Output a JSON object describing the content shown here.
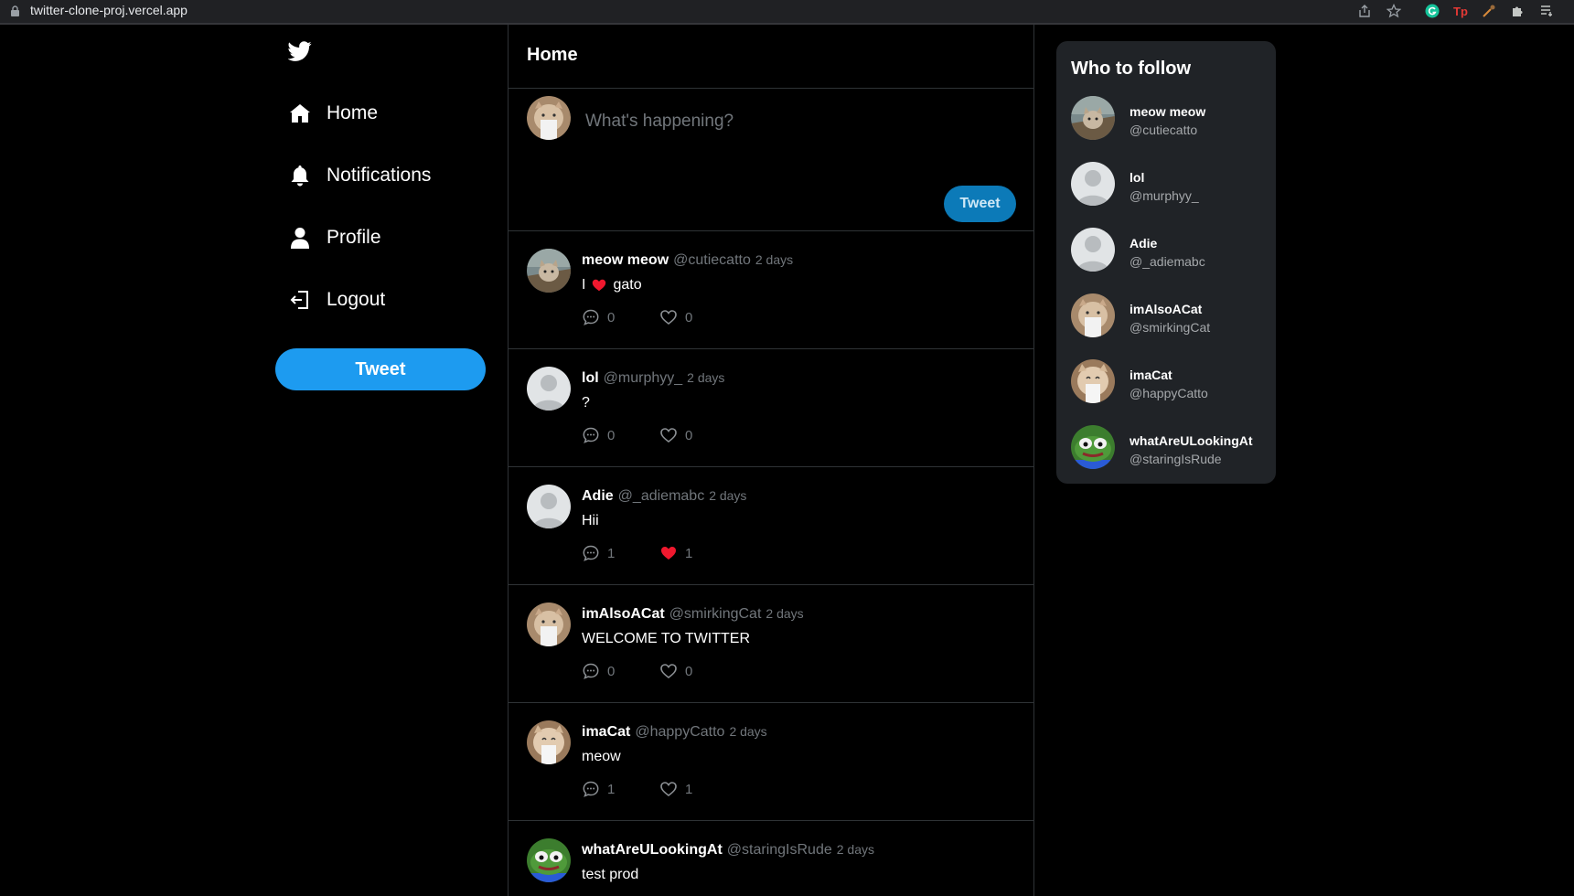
{
  "browser": {
    "url": "twitter-clone-proj.vercel.app"
  },
  "sidebar": {
    "logo_icon": "twitter-bird-icon",
    "items": [
      {
        "label": "Home",
        "icon": "home-icon"
      },
      {
        "label": "Notifications",
        "icon": "bell-icon"
      },
      {
        "label": "Profile",
        "icon": "user-icon"
      },
      {
        "label": "Logout",
        "icon": "logout-icon"
      }
    ],
    "tweet_button": "Tweet"
  },
  "feed": {
    "title": "Home",
    "composer": {
      "placeholder": "What's happening?",
      "button": "Tweet"
    },
    "tweets": [
      {
        "name": "meow meow",
        "handle": "@cutiecatto",
        "time": "2 days",
        "text_before": "I",
        "heart_emoji": true,
        "text_after": "gato",
        "replies": "0",
        "likes": "0",
        "liked": false,
        "avatar": "cat-tree"
      },
      {
        "name": "lol",
        "handle": "@murphyy_",
        "time": "2 days",
        "text_before": "?",
        "heart_emoji": false,
        "text_after": "",
        "replies": "0",
        "likes": "0",
        "liked": false,
        "avatar": "default"
      },
      {
        "name": "Adie",
        "handle": "@_adiemabc",
        "time": "2 days",
        "text_before": "Hii",
        "heart_emoji": false,
        "text_after": "",
        "replies": "1",
        "likes": "1",
        "liked": true,
        "avatar": "default"
      },
      {
        "name": "imAlsoACat",
        "handle": "@smirkingCat",
        "time": "2 days",
        "text_before": "WELCOME TO TWITTER",
        "heart_emoji": false,
        "text_after": "",
        "replies": "0",
        "likes": "0",
        "liked": false,
        "avatar": "cat-white"
      },
      {
        "name": "imaCat",
        "handle": "@happyCatto",
        "time": "2 days",
        "text_before": "meow",
        "heart_emoji": false,
        "text_after": "",
        "replies": "1",
        "likes": "1",
        "liked": false,
        "avatar": "cat-happy"
      },
      {
        "name": "whatAreULookingAt",
        "handle": "@staringIsRude",
        "time": "2 days",
        "text_before": "test prod",
        "heart_emoji": false,
        "text_after": "",
        "replies": "",
        "likes": "",
        "liked": false,
        "avatar": "frog"
      }
    ]
  },
  "who_to_follow": {
    "title": "Who to follow",
    "users": [
      {
        "name": "meow meow",
        "handle": "@cutiecatto",
        "avatar": "cat-tree"
      },
      {
        "name": "lol",
        "handle": "@murphyy_",
        "avatar": "default"
      },
      {
        "name": "Adie",
        "handle": "@_adiemabc",
        "avatar": "default"
      },
      {
        "name": "imAlsoACat",
        "handle": "@smirkingCat",
        "avatar": "cat-white"
      },
      {
        "name": "imaCat",
        "handle": "@happyCatto",
        "avatar": "cat-happy"
      },
      {
        "name": "whatAreULookingAt",
        "handle": "@staringIsRude",
        "avatar": "frog"
      }
    ]
  },
  "colors": {
    "accent": "#1d9bf0",
    "like_red": "#f91880",
    "background": "#000000",
    "panel": "#202327"
  }
}
